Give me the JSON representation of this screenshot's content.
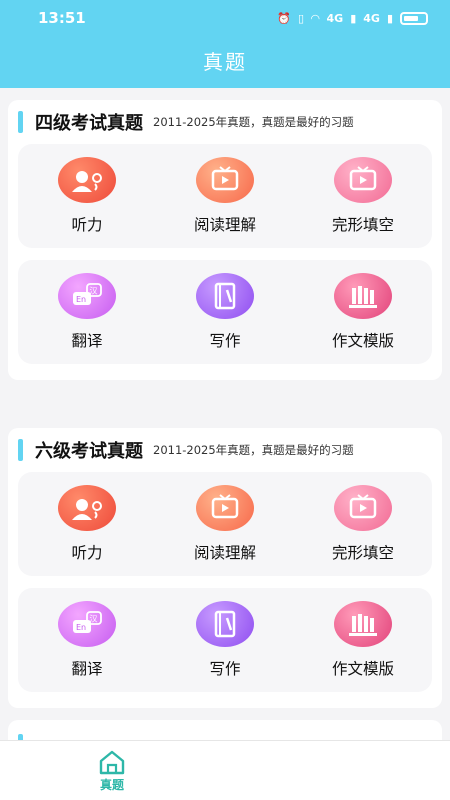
{
  "status": {
    "time": "13:51",
    "net_a": "4G",
    "net_b": "4G"
  },
  "header": {
    "title": "真题"
  },
  "sections": [
    {
      "title": "四级考试真题",
      "subtitle": "2011-2025年真题，真题是最好的习题",
      "items": [
        "听力",
        "阅读理解",
        "完形填空",
        "翻译",
        "写作",
        "作文模版"
      ]
    },
    {
      "title": "六级考试真题",
      "subtitle": "2011-2025年真题，真题是最好的习题",
      "items": [
        "听力",
        "阅读理解",
        "完形填空",
        "翻译",
        "写作",
        "作文模版"
      ]
    }
  ],
  "tabbar": {
    "home_label": "真题"
  },
  "colors": {
    "accent": "#62d4f2",
    "tab_active": "#2db7a8"
  }
}
